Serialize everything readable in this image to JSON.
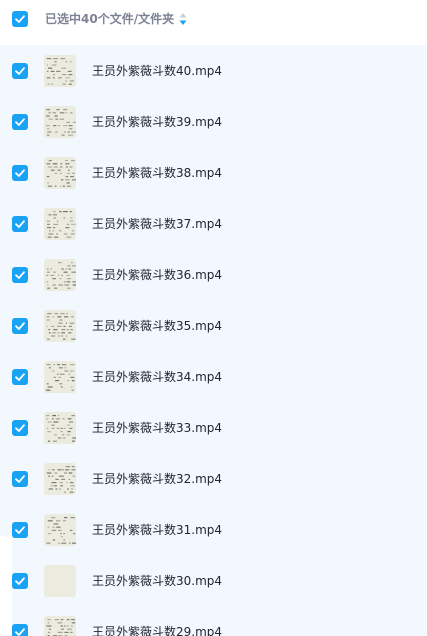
{
  "header": {
    "selection_text": "已选中40个文件/文件夹",
    "select_all_checked": true,
    "sort_icon": "sort-toggle-icon"
  },
  "files": [
    {
      "name": "王员外紫薇斗数40.mp4",
      "checked": true
    },
    {
      "name": "王员外紫薇斗数39.mp4",
      "checked": true
    },
    {
      "name": "王员外紫薇斗数38.mp4",
      "checked": true
    },
    {
      "name": "王员外紫薇斗数37.mp4",
      "checked": true
    },
    {
      "name": "王员外紫薇斗数36.mp4",
      "checked": true
    },
    {
      "name": "王员外紫薇斗数35.mp4",
      "checked": true
    },
    {
      "name": "王员外紫薇斗数34.mp4",
      "checked": true
    },
    {
      "name": "王员外紫薇斗数33.mp4",
      "checked": true
    },
    {
      "name": "王员外紫薇斗数32.mp4",
      "checked": true
    },
    {
      "name": "王员外紫薇斗数31.mp4",
      "checked": true
    },
    {
      "name": "王员外紫薇斗数30.mp4",
      "checked": true
    },
    {
      "name": "王员外紫薇斗数29.mp4",
      "checked": true
    }
  ],
  "colors": {
    "accent": "#1aa3f5",
    "list_background": "#f3f8ff",
    "thumbnail_background": "#ecebe0",
    "text_primary": "#222631",
    "text_secondary": "#7c8394"
  }
}
